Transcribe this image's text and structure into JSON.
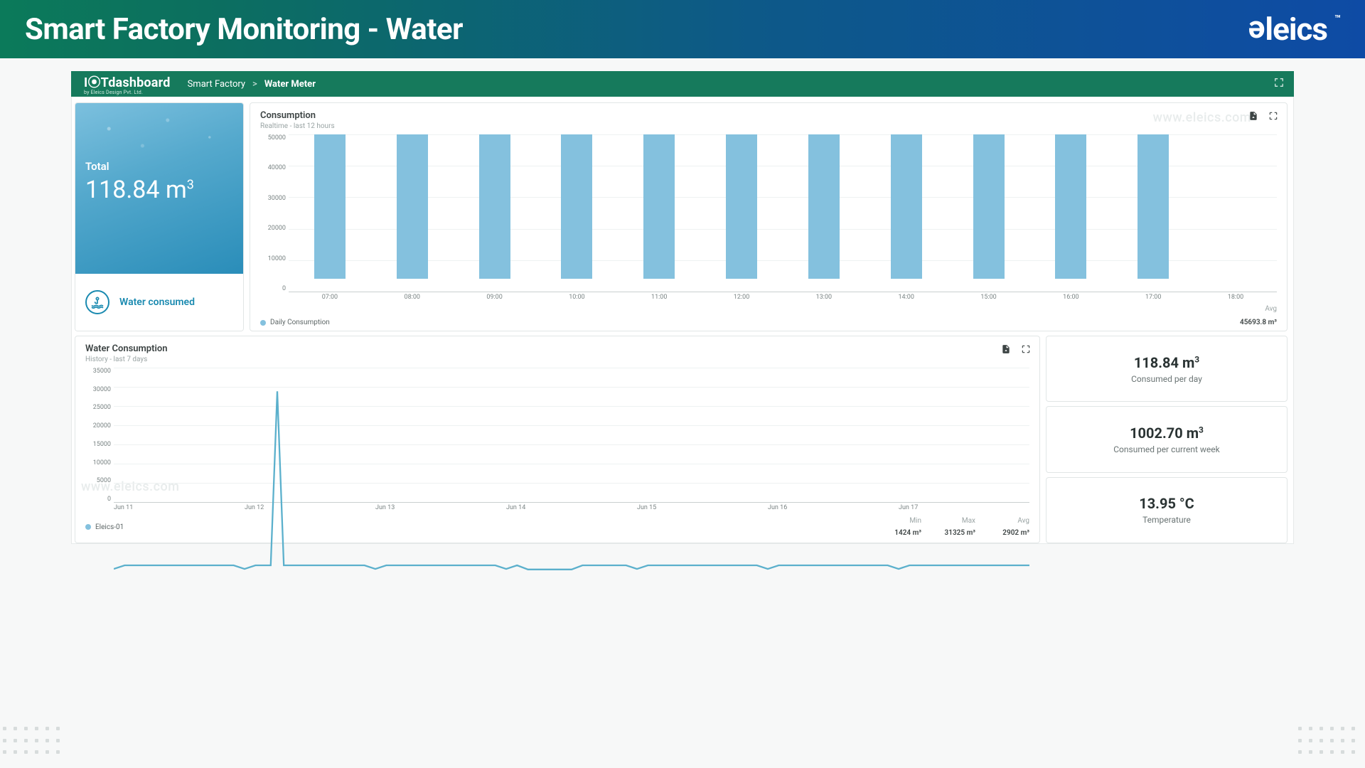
{
  "header": {
    "title": "Smart Factory Monitoring - Water",
    "brand": "eleics",
    "brand_tm": "™"
  },
  "appbar": {
    "logo_main": "I⦿Tdashboard",
    "logo_sub": "by Eleics Design Pvt. Ltd.",
    "crumb1": "Smart Factory",
    "sep": ">",
    "crumb2": "Water Meter"
  },
  "total_card": {
    "label": "Total",
    "value": "118.84 m",
    "exp": "3",
    "bottom": "Water consumed"
  },
  "watermark": "www.eleics.com",
  "consumption": {
    "title": "Consumption",
    "subtitle": "Realtime - last 12 hours",
    "legend": "Daily Consumption",
    "avg_label": "Avg",
    "avg_value": "45693.8 m³"
  },
  "history": {
    "title": "Water Consumption",
    "subtitle": "History - last 7 days",
    "legend": "Eleics-01",
    "stats": {
      "min_h": "Min",
      "min_v": "1424 m³",
      "max_h": "Max",
      "max_v": "31325 m³",
      "avg_h": "Avg",
      "avg_v": "2902 m³"
    }
  },
  "metrics": [
    {
      "value": "118.84 m",
      "exp": "3",
      "label": "Consumed per day"
    },
    {
      "value": "1002.70 m",
      "exp": "3",
      "label": "Consumed per current week"
    },
    {
      "value": "13.95 °C",
      "exp": "",
      "label": "Temperature"
    }
  ],
  "chart_data": [
    {
      "type": "bar",
      "title": "Consumption",
      "subtitle": "Realtime - last 12 hours",
      "ylabel": "",
      "ylim": [
        0,
        50000
      ],
      "y_ticks": [
        50000,
        40000,
        30000,
        20000,
        10000,
        0
      ],
      "categories": [
        "07:00",
        "08:00",
        "09:00",
        "10:00",
        "11:00",
        "12:00",
        "13:00",
        "14:00",
        "15:00",
        "16:00",
        "17:00",
        "18:00"
      ],
      "series": [
        {
          "name": "Daily Consumption",
          "values": [
            45700,
            45700,
            45700,
            45700,
            45700,
            45700,
            45700,
            45700,
            45700,
            45700,
            45700,
            null
          ]
        }
      ],
      "avg": 45693.8,
      "unit": "m³"
    },
    {
      "type": "line",
      "title": "Water Consumption",
      "subtitle": "History - last 7 days",
      "ylabel": "",
      "ylim": [
        0,
        35000
      ],
      "y_ticks": [
        35000,
        30000,
        25000,
        20000,
        15000,
        10000,
        5000,
        0
      ],
      "categories": [
        "Jun 11",
        "Jun 12",
        "Jun 13",
        "Jun 14",
        "Jun 15",
        "Jun 16",
        "Jun 17"
      ],
      "series": [
        {
          "name": "Eleics-01",
          "values_approx": "mostly ~1400-2000 with one spike to ~31325 near Jun 12 and a small dip near Jun 13/14",
          "min": 1424,
          "max": 31325,
          "avg": 2902
        }
      ],
      "unit": "m³"
    }
  ]
}
